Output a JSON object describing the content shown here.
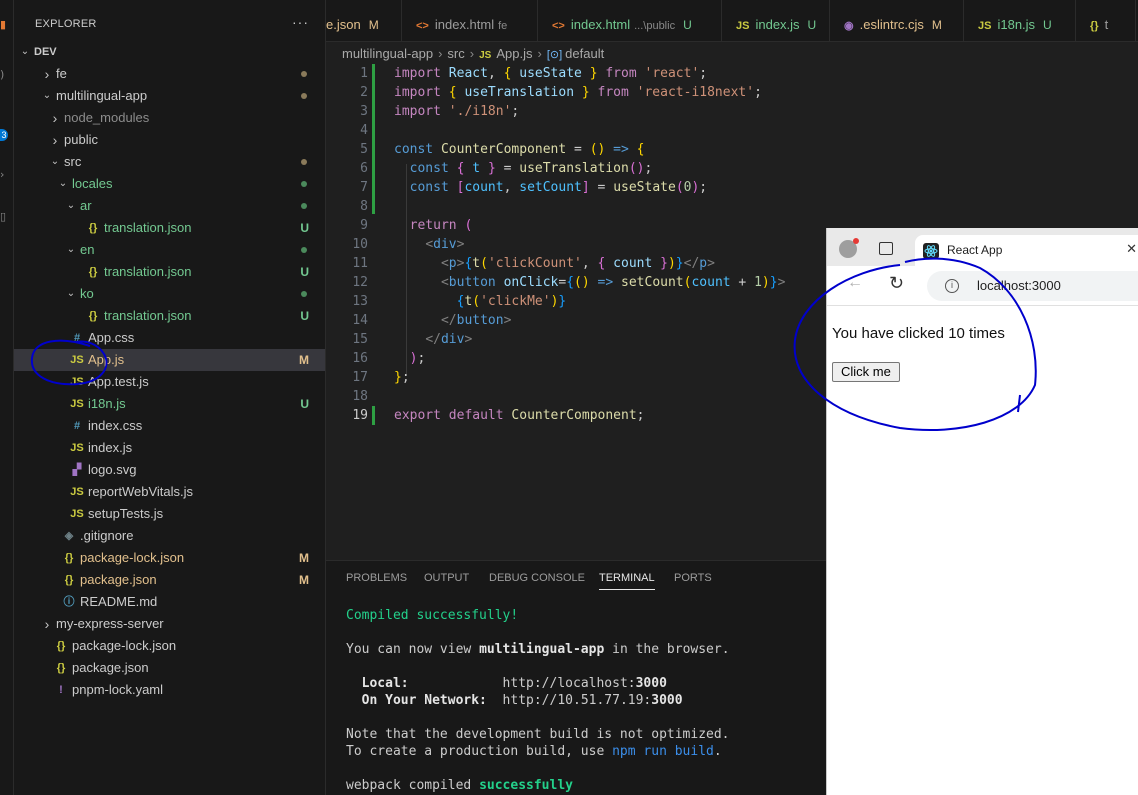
{
  "sidebar": {
    "title": "EXPLORER",
    "more": "···",
    "tree": [
      {
        "label": "DEV",
        "level": 0,
        "type": "root",
        "open": true
      },
      {
        "label": "fe",
        "level": 1,
        "type": "folder",
        "open": false,
        "dot": "#8a7a5a"
      },
      {
        "label": "multilingual-app",
        "level": 1,
        "type": "folder",
        "open": true,
        "dot": "#8a7a5a"
      },
      {
        "label": "node_modules",
        "level": 2,
        "type": "folder",
        "open": false,
        "dim": true
      },
      {
        "label": "public",
        "level": 2,
        "type": "folder",
        "open": false
      },
      {
        "label": "src",
        "level": 2,
        "type": "folder",
        "open": true,
        "dot": "#8a7a5a"
      },
      {
        "label": "locales",
        "level": 3,
        "type": "folder",
        "open": true,
        "color": "#73c991",
        "dot": "#4b8a5c"
      },
      {
        "label": "ar",
        "level": 4,
        "type": "folder",
        "open": true,
        "color": "#73c991",
        "dot": "#4b8a5c"
      },
      {
        "label": "translation.json",
        "level": 5,
        "type": "json",
        "color": "#73c991",
        "status": "U"
      },
      {
        "label": "en",
        "level": 4,
        "type": "folder",
        "open": true,
        "color": "#73c991",
        "dot": "#4b8a5c"
      },
      {
        "label": "translation.json",
        "level": 5,
        "type": "json",
        "color": "#73c991",
        "status": "U"
      },
      {
        "label": "ko",
        "level": 4,
        "type": "folder",
        "open": true,
        "color": "#73c991",
        "dot": "#4b8a5c"
      },
      {
        "label": "translation.json",
        "level": 5,
        "type": "json",
        "color": "#73c991",
        "status": "U"
      },
      {
        "label": "App.css",
        "level": 3,
        "type": "css"
      },
      {
        "label": "App.js",
        "level": 3,
        "type": "js",
        "color": "#e2c08d",
        "status": "M",
        "selected": true
      },
      {
        "label": "App.test.js",
        "level": 3,
        "type": "js"
      },
      {
        "label": "i18n.js",
        "level": 3,
        "type": "js",
        "color": "#73c991",
        "status": "U"
      },
      {
        "label": "index.css",
        "level": 3,
        "type": "css"
      },
      {
        "label": "index.js",
        "level": 3,
        "type": "js"
      },
      {
        "label": "logo.svg",
        "level": 3,
        "type": "svg"
      },
      {
        "label": "reportWebVitals.js",
        "level": 3,
        "type": "js"
      },
      {
        "label": "setupTests.js",
        "level": 3,
        "type": "js"
      },
      {
        "label": ".gitignore",
        "level": 2,
        "type": "git"
      },
      {
        "label": "package-lock.json",
        "level": 2,
        "type": "json",
        "color": "#e2c08d",
        "status": "M"
      },
      {
        "label": "package.json",
        "level": 2,
        "type": "json",
        "color": "#e2c08d",
        "status": "M"
      },
      {
        "label": "README.md",
        "level": 2,
        "type": "info"
      },
      {
        "label": "my-express-server",
        "level": 1,
        "type": "folder",
        "open": false
      },
      {
        "label": "package-lock.json",
        "level": 1,
        "type": "json"
      },
      {
        "label": "package.json",
        "level": 1,
        "type": "json"
      },
      {
        "label": "pnpm-lock.yaml",
        "level": 1,
        "type": "yaml"
      }
    ]
  },
  "tabs": [
    {
      "icon": "",
      "label": "e.json",
      "status": "M",
      "statusColor": "#e2c08d",
      "labelColor": "#e2c08d"
    },
    {
      "icon": "<>",
      "label": "index.html",
      "sub": "fe",
      "iconColor": "#e37933"
    },
    {
      "icon": "<>",
      "label": "index.html",
      "sub": "...\\public",
      "status": "U",
      "statusColor": "#73c991",
      "iconColor": "#e37933",
      "labelColor": "#73c991"
    },
    {
      "icon": "JS",
      "label": "index.js",
      "status": "U",
      "statusColor": "#73c991",
      "iconColor": "#cbcb41",
      "labelColor": "#73c991"
    },
    {
      "icon": "◉",
      "label": ".eslintrc.cjs",
      "status": "M",
      "statusColor": "#e2c08d",
      "iconColor": "#a074c4",
      "labelColor": "#e2c08d"
    },
    {
      "icon": "JS",
      "label": "i18n.js",
      "status": "U",
      "statusColor": "#73c991",
      "iconColor": "#cbcb41",
      "labelColor": "#73c991"
    },
    {
      "icon": "{}",
      "label": "t",
      "iconColor": "#cbcb41"
    }
  ],
  "breadcrumb": {
    "parts": [
      "multilingual-app",
      "src",
      "App.js",
      "default"
    ],
    "js_icon": "JS",
    "sym_icon": "[⊙]"
  },
  "editor": {
    "line_numbers": [
      "1",
      "2",
      "3",
      "4",
      "5",
      "6",
      "7",
      "8",
      "9",
      "10",
      "11",
      "12",
      "13",
      "14",
      "15",
      "16",
      "17",
      "18",
      "19"
    ],
    "active_line": 19
  },
  "panel": {
    "tabs": [
      "PROBLEMS",
      "OUTPUT",
      "DEBUG CONSOLE",
      "TERMINAL",
      "PORTS"
    ],
    "active_tab": "TERMINAL",
    "terminal": {
      "compiled": "Compiled successfully!",
      "view_pre": "You can now view ",
      "view_app": "multilingual-app",
      "view_post": " in the browser.",
      "local_label": "  Local:",
      "local_url_pre": "http://localhost:",
      "local_port": "3000",
      "network_label": "  On Your Network:",
      "network_url_pre": "http://10.51.77.19:",
      "network_port": "3000",
      "note1": "Note that the development build is not optimized.",
      "note2_pre": "To create a production build, use ",
      "note2_cmd": "npm run build",
      "note2_post": ".",
      "webpack_pre": "webpack compiled ",
      "webpack_status": "successfully"
    }
  },
  "browser": {
    "tab_title": "React App",
    "url": "localhost:3000",
    "page_text": "You have clicked 10 times",
    "button_label": "Click me"
  },
  "colors": {
    "annotation": "#0000cc",
    "accent": "#0078d4",
    "untracked": "#73c991",
    "modified": "#e2c08d"
  }
}
